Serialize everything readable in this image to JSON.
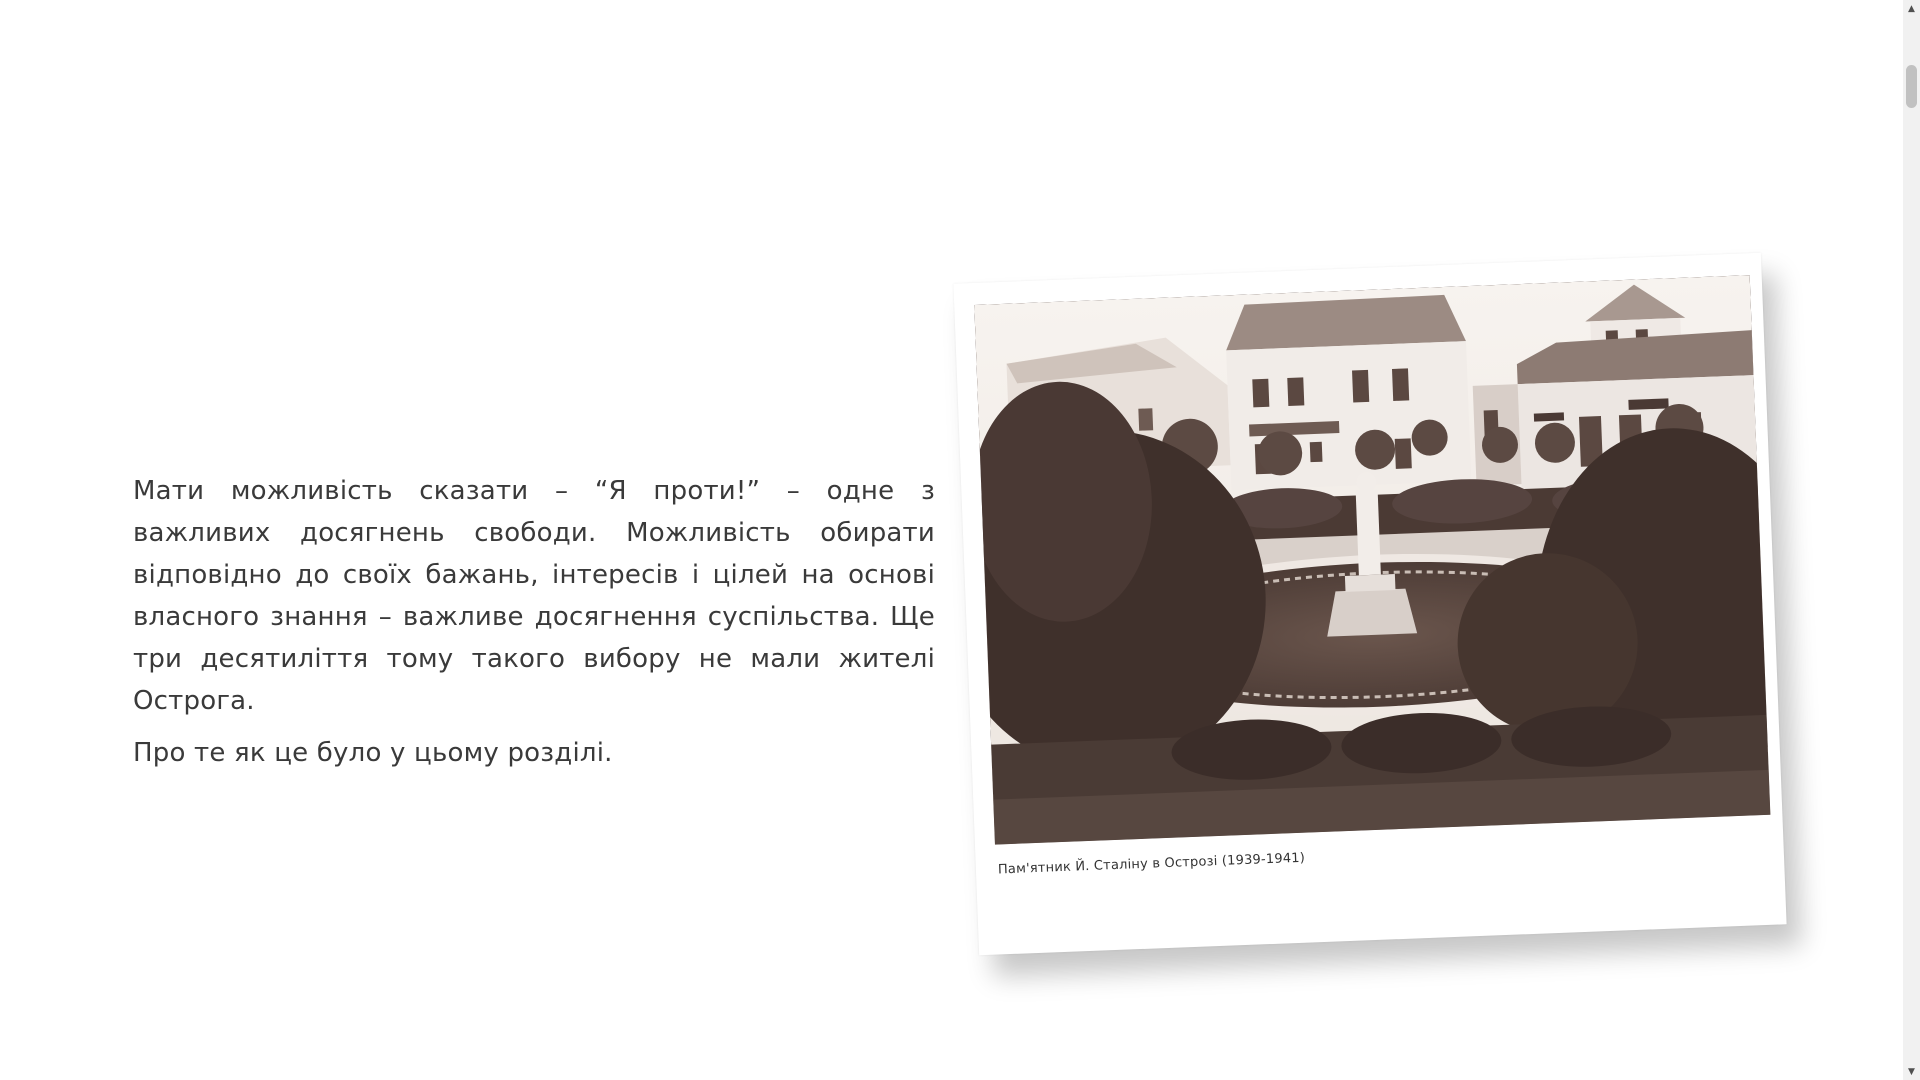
{
  "intro": {
    "paragraph_1": "Мати можливість сказати – “Я проти!” – одне з важливих досягнень свободи. Можливість обирати відповідно до своїх бажань, інтересів і цілей на основі власного знання – важливе досягнення суспільства. Ще три десятиліття тому такого вибору не мали жителі Острога.",
    "paragraph_2": "Про те як це було у цьому розділі."
  },
  "photo": {
    "caption": "Пам'ятник Й. Сталіну в Острозі (1939-1941)"
  },
  "scrollbar": {
    "up_icon": "▲",
    "down_icon": "▼"
  }
}
